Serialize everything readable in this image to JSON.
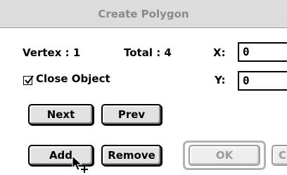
{
  "window": {
    "title": "Create Polygon"
  },
  "vertex": {
    "label": "Vertex : 1",
    "total_label": "Total : 4"
  },
  "coords": {
    "x_label": "X:",
    "x_value": "0",
    "y_label": "Y:",
    "y_value": "0"
  },
  "close_object": {
    "label": "Close Object",
    "checked": true
  },
  "buttons": {
    "next": "Next",
    "prev": "Prev",
    "add": "Add",
    "remove": "Remove",
    "ok": "OK",
    "cancel": "C"
  },
  "icons": {
    "checkbox": "checkmark-icon",
    "cursor": "arrow-plus-cursor-icon"
  },
  "colors": {
    "titlebar": "#dcdcdc",
    "disabled": "#9b9b9b",
    "button_face": "#e2e2e2"
  }
}
